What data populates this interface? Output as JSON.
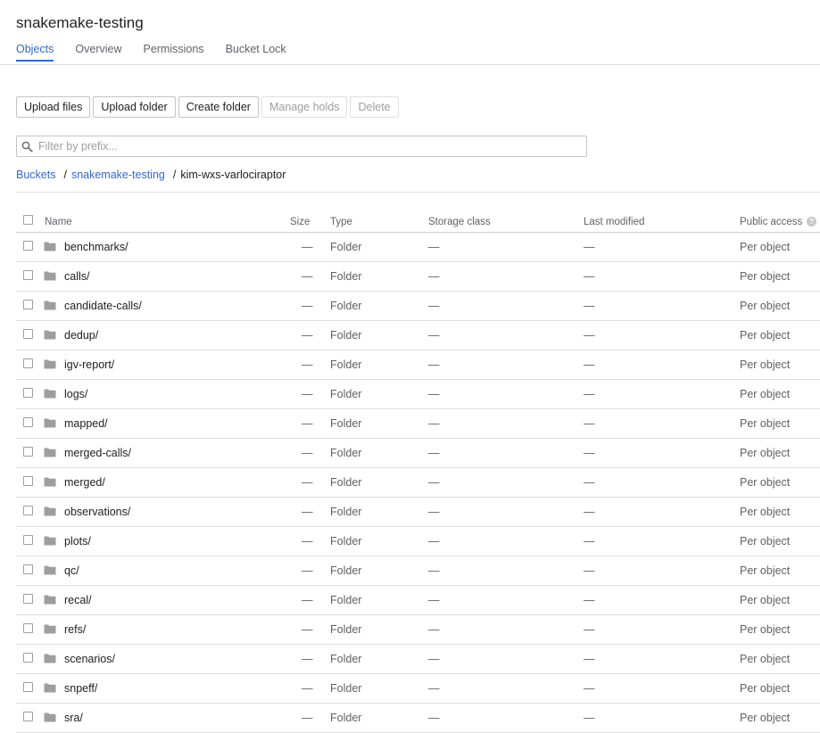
{
  "bucket_title": "snakemake-testing",
  "tabs": [
    {
      "label": "Objects",
      "active": true
    },
    {
      "label": "Overview",
      "active": false
    },
    {
      "label": "Permissions",
      "active": false
    },
    {
      "label": "Bucket Lock",
      "active": false
    }
  ],
  "toolbar": {
    "upload_files": "Upload files",
    "upload_folder": "Upload folder",
    "create_folder": "Create folder",
    "manage_holds": "Manage holds",
    "delete": "Delete"
  },
  "filter": {
    "placeholder": "Filter by prefix...",
    "value": "",
    "icon": "search-icon"
  },
  "breadcrumb": {
    "items": [
      "Buckets",
      "snakemake-testing"
    ],
    "separator": "/",
    "current": "kim-wxs-varlociraptor"
  },
  "table": {
    "columns": {
      "name": "Name",
      "size": "Size",
      "type": "Type",
      "storage_class": "Storage class",
      "last_modified": "Last modified",
      "public_access": "Public access"
    },
    "help_icon": "?",
    "rows": [
      {
        "name": "benchmarks/",
        "size": "—",
        "type": "Folder",
        "storage_class": "—",
        "last_modified": "—",
        "public_access": "Per object"
      },
      {
        "name": "calls/",
        "size": "—",
        "type": "Folder",
        "storage_class": "—",
        "last_modified": "—",
        "public_access": "Per object"
      },
      {
        "name": "candidate-calls/",
        "size": "—",
        "type": "Folder",
        "storage_class": "—",
        "last_modified": "—",
        "public_access": "Per object"
      },
      {
        "name": "dedup/",
        "size": "—",
        "type": "Folder",
        "storage_class": "—",
        "last_modified": "—",
        "public_access": "Per object"
      },
      {
        "name": "igv-report/",
        "size": "—",
        "type": "Folder",
        "storage_class": "—",
        "last_modified": "—",
        "public_access": "Per object"
      },
      {
        "name": "logs/",
        "size": "—",
        "type": "Folder",
        "storage_class": "—",
        "last_modified": "—",
        "public_access": "Per object"
      },
      {
        "name": "mapped/",
        "size": "—",
        "type": "Folder",
        "storage_class": "—",
        "last_modified": "—",
        "public_access": "Per object"
      },
      {
        "name": "merged-calls/",
        "size": "—",
        "type": "Folder",
        "storage_class": "—",
        "last_modified": "—",
        "public_access": "Per object"
      },
      {
        "name": "merged/",
        "size": "—",
        "type": "Folder",
        "storage_class": "—",
        "last_modified": "—",
        "public_access": "Per object"
      },
      {
        "name": "observations/",
        "size": "—",
        "type": "Folder",
        "storage_class": "—",
        "last_modified": "—",
        "public_access": "Per object"
      },
      {
        "name": "plots/",
        "size": "—",
        "type": "Folder",
        "storage_class": "—",
        "last_modified": "—",
        "public_access": "Per object"
      },
      {
        "name": "qc/",
        "size": "—",
        "type": "Folder",
        "storage_class": "—",
        "last_modified": "—",
        "public_access": "Per object"
      },
      {
        "name": "recal/",
        "size": "—",
        "type": "Folder",
        "storage_class": "—",
        "last_modified": "—",
        "public_access": "Per object"
      },
      {
        "name": "refs/",
        "size": "—",
        "type": "Folder",
        "storage_class": "—",
        "last_modified": "—",
        "public_access": "Per object"
      },
      {
        "name": "scenarios/",
        "size": "—",
        "type": "Folder",
        "storage_class": "—",
        "last_modified": "—",
        "public_access": "Per object"
      },
      {
        "name": "snpeff/",
        "size": "—",
        "type": "Folder",
        "storage_class": "—",
        "last_modified": "—",
        "public_access": "Per object"
      },
      {
        "name": "sra/",
        "size": "—",
        "type": "Folder",
        "storage_class": "—",
        "last_modified": "—",
        "public_access": "Per object"
      }
    ]
  },
  "colors": {
    "accent": "#3367d6",
    "folder_icon": "#9e9e9e",
    "disabled_text": "#9e9e9e",
    "divider": "#e0e0e0"
  }
}
